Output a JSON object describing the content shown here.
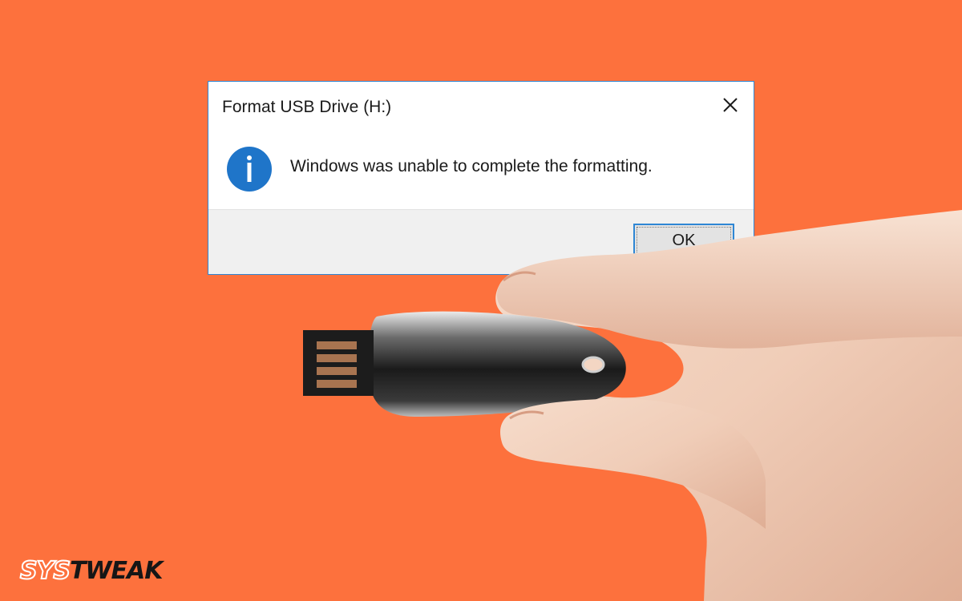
{
  "dialog": {
    "title": "Format USB Drive (H:)",
    "message": "Windows was unable to complete the formatting.",
    "ok_label": "OK",
    "close_icon": "close-icon",
    "info_icon": "info-icon"
  },
  "logo": {
    "part1": "SYS",
    "part2": "TWEAK"
  },
  "colors": {
    "background": "#fd713d",
    "accent": "#2e86d4",
    "info_icon": "#1f75c9"
  }
}
